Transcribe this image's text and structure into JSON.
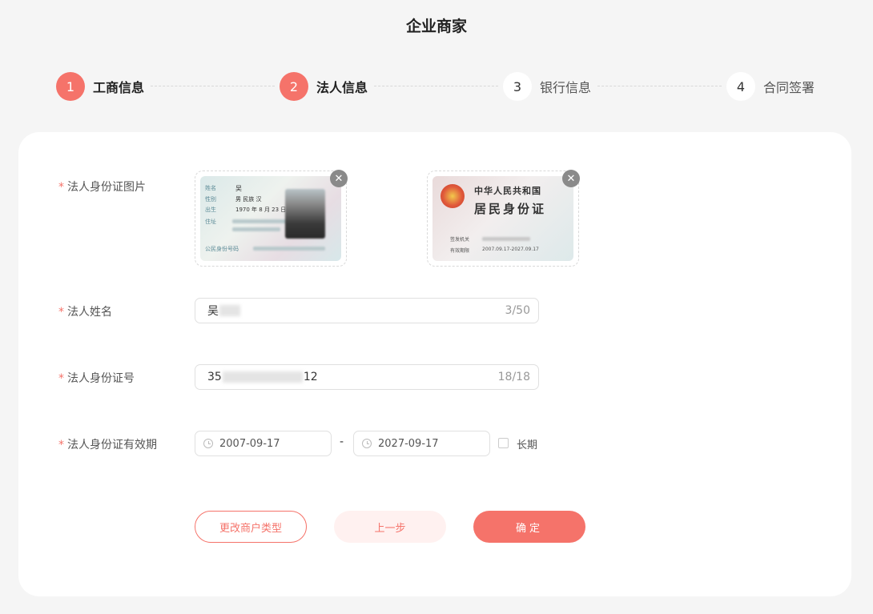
{
  "header": {
    "title": "企业商家"
  },
  "steps": [
    {
      "number": "1",
      "label": "工商信息",
      "state": "active"
    },
    {
      "number": "2",
      "label": "法人信息",
      "state": "active"
    },
    {
      "number": "3",
      "label": "银行信息",
      "state": "inactive"
    },
    {
      "number": "4",
      "label": "合同签署",
      "state": "inactive"
    }
  ],
  "form": {
    "id_photo": {
      "label": "法人身份证图片",
      "remove_icon": "close-icon",
      "front": {
        "name": "吴",
        "sex_line": "男  民族 汉",
        "birth_line": "1970 年 8 月 23 日"
      },
      "back": {
        "line1": "中华人民共和国",
        "line2": "居民身份证",
        "validity": "2007.09.17-2027.09.17"
      }
    },
    "name": {
      "label": "法人姓名",
      "value": "吴",
      "counter": "3/50"
    },
    "id_number": {
      "label": "法人身份证号",
      "value_prefix": "35",
      "value_suffix": "12",
      "counter": "18/18"
    },
    "validity": {
      "label": "法人身份证有效期",
      "start": "2007-09-17",
      "separator": "-",
      "end": "2027-09-17",
      "long_term_label": "长期",
      "long_term_checked": false
    },
    "required_mark": "*"
  },
  "buttons": {
    "change_type": "更改商户类型",
    "prev": "上一步",
    "confirm": "确定"
  },
  "colors": {
    "accent": "#f5736a",
    "accent_light": "#fff1f0",
    "background": "#f5f5f5"
  }
}
